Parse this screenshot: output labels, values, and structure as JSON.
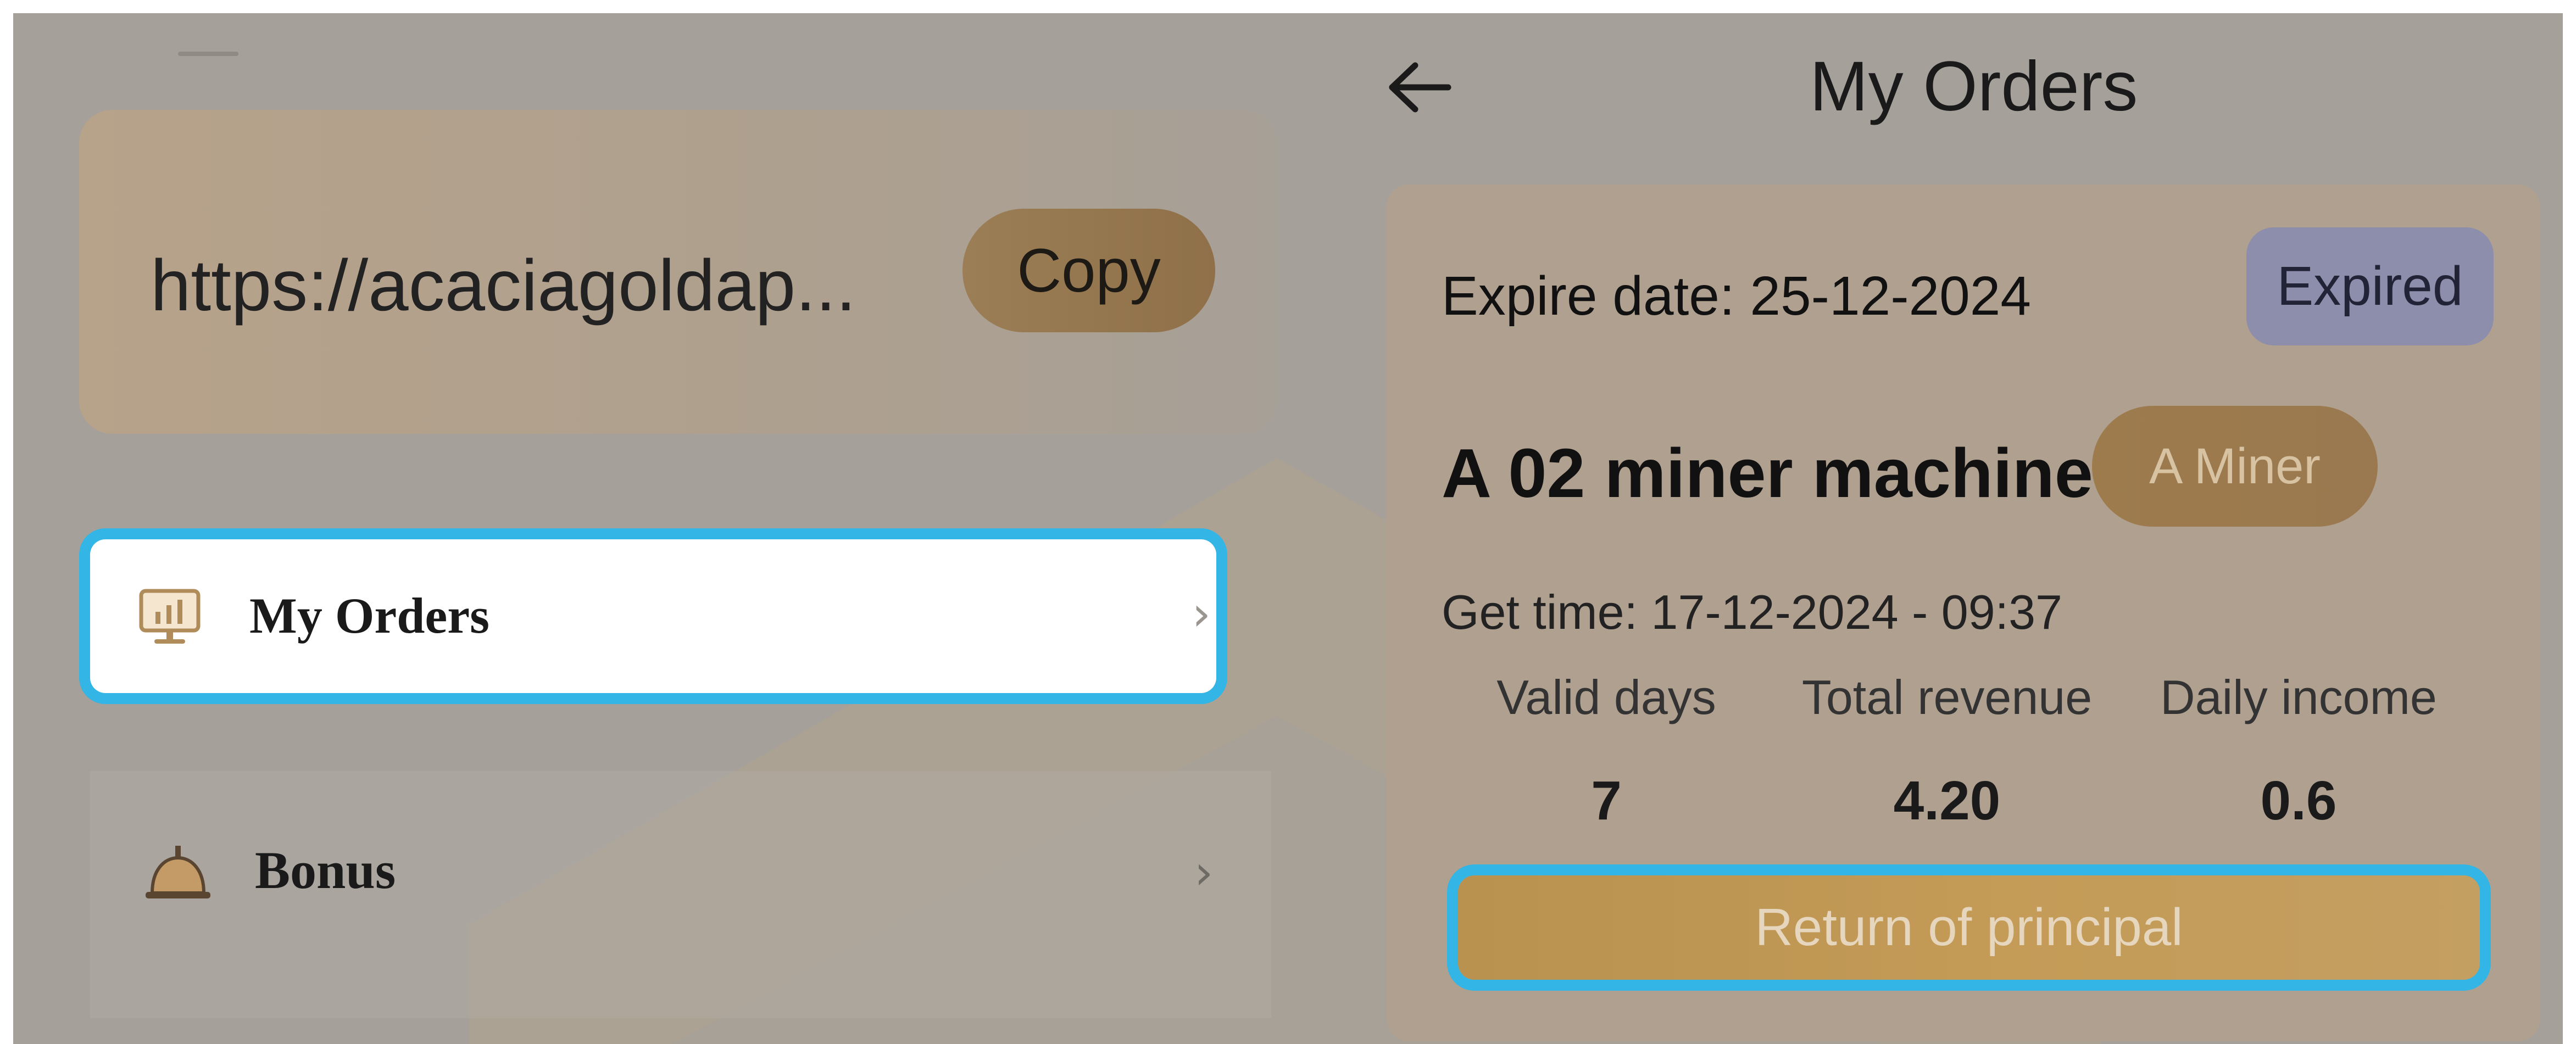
{
  "left_panel": {
    "invite_link": "https://acaciagoldap...",
    "copy_label": "Copy",
    "menu": [
      {
        "label": "My Orders",
        "icon": "chart-monitor-icon",
        "highlighted": true
      },
      {
        "label": "Bonus",
        "icon": "bell-icon",
        "highlighted": false
      }
    ]
  },
  "right_panel": {
    "title": "My Orders",
    "order": {
      "expire_text": "Expire date: 25-12-2024",
      "status": "Expired",
      "product_name": "A 02 miner machine",
      "product_type": "A Miner",
      "get_time_text": "Get time: 17-12-2024 - 09:37",
      "stats": [
        {
          "label": "Valid days",
          "value": "7"
        },
        {
          "label": "Total revenue",
          "value": "4.20"
        },
        {
          "label": "Daily income",
          "value": "0.6"
        }
      ],
      "action_label": "Return of principal"
    }
  },
  "colors": {
    "highlight_outline": "#33b5e6",
    "gold_accent": "#9d7b4d",
    "expired_badge": "#8c8eab"
  }
}
